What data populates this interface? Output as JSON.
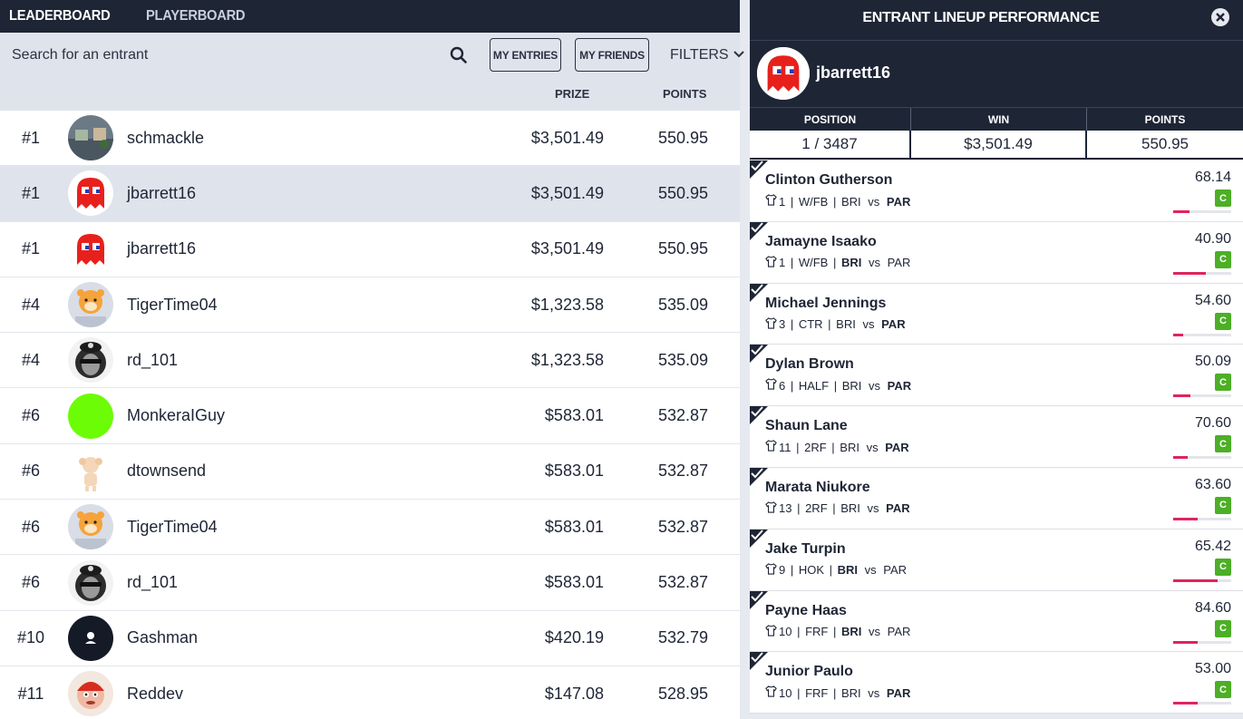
{
  "tabs": {
    "leaderboard": "LEADERBOARD",
    "playerboard": "PLAYERBOARD"
  },
  "search": {
    "placeholder": "Search for an entrant"
  },
  "buttons": {
    "my_entries": "MY ENTRIES",
    "my_friends": "MY FRIENDS",
    "filters": "FILTERS"
  },
  "columns": {
    "prize": "PRIZE",
    "points": "POINTS"
  },
  "entrants": [
    {
      "rank": "#1",
      "name": "schmackle",
      "prize": "$3,501.49",
      "points": "550.95",
      "avatar": "photo-avatar"
    },
    {
      "rank": "#1",
      "name": "jbarrett16",
      "prize": "$3,501.49",
      "points": "550.95",
      "avatar": "ghost-avatar",
      "selected": true
    },
    {
      "rank": "#1",
      "name": "jbarrett16",
      "prize": "$3,501.49",
      "points": "550.95",
      "avatar": "ghost-avatar"
    },
    {
      "rank": "#4",
      "name": "TigerTime04",
      "prize": "$1,323.58",
      "points": "535.09",
      "avatar": "tiger-avatar"
    },
    {
      "rank": "#4",
      "name": "rd_101",
      "prize": "$1,323.58",
      "points": "535.09",
      "avatar": "lion-avatar"
    },
    {
      "rank": "#6",
      "name": "MonkeraIGuy",
      "prize": "$583.01",
      "points": "532.87",
      "avatar": "green-avatar"
    },
    {
      "rank": "#6",
      "name": "dtownsend",
      "prize": "$583.01",
      "points": "532.87",
      "avatar": "doll-avatar"
    },
    {
      "rank": "#6",
      "name": "TigerTime04",
      "prize": "$583.01",
      "points": "532.87",
      "avatar": "tiger-avatar"
    },
    {
      "rank": "#6",
      "name": "rd_101",
      "prize": "$583.01",
      "points": "532.87",
      "avatar": "lion-avatar"
    },
    {
      "rank": "#10",
      "name": "Gashman",
      "prize": "$420.19",
      "points": "532.79",
      "avatar": "default-avatar"
    },
    {
      "rank": "#11",
      "name": "Reddev",
      "prize": "$147.08",
      "points": "528.95",
      "avatar": "cartoon-avatar"
    }
  ],
  "panel": {
    "title": "ENTRANT LINEUP PERFORMANCE",
    "username": "jbarrett16",
    "stat_labels": {
      "position": "POSITION",
      "win": "WIN",
      "points": "POINTS"
    },
    "stat_values": {
      "position": "1 / 3487",
      "win": "$3,501.49",
      "points": "550.95"
    },
    "players": [
      {
        "name": "Clinton Gutherson",
        "num": "1",
        "pos": "W/FB",
        "team": "BRI",
        "vs": "vs",
        "opp": "PAR",
        "bold": "opp",
        "points": "68.14",
        "badge": "C",
        "fill": 0.28
      },
      {
        "name": "Jamayne Isaako",
        "num": "1",
        "pos": "W/FB",
        "team": "BRI",
        "vs": "vs",
        "opp": "PAR",
        "bold": "team",
        "points": "40.90",
        "badge": "C",
        "fill": 0.56
      },
      {
        "name": "Michael Jennings",
        "num": "3",
        "pos": "CTR",
        "team": "BRI",
        "vs": "vs",
        "opp": "PAR",
        "bold": "opp",
        "points": "54.60",
        "badge": "C",
        "fill": 0.17
      },
      {
        "name": "Dylan Brown",
        "num": "6",
        "pos": "HALF",
        "team": "BRI",
        "vs": "vs",
        "opp": "PAR",
        "bold": "opp",
        "points": "50.09",
        "badge": "C",
        "fill": 0.3
      },
      {
        "name": "Shaun Lane",
        "num": "11",
        "pos": "2RF",
        "team": "BRI",
        "vs": "vs",
        "opp": "PAR",
        "bold": "opp",
        "points": "70.60",
        "badge": "C",
        "fill": 0.25
      },
      {
        "name": "Marata Niukore",
        "num": "13",
        "pos": "2RF",
        "team": "BRI",
        "vs": "vs",
        "opp": "PAR",
        "bold": "opp",
        "points": "63.60",
        "badge": "C",
        "fill": 0.42
      },
      {
        "name": "Jake Turpin",
        "num": "9",
        "pos": "HOK",
        "team": "BRI",
        "vs": "vs",
        "opp": "PAR",
        "bold": "team",
        "points": "65.42",
        "badge": "C",
        "fill": 0.77
      },
      {
        "name": "Payne Haas",
        "num": "10",
        "pos": "FRF",
        "team": "BRI",
        "vs": "vs",
        "opp": "PAR",
        "bold": "team",
        "points": "84.60",
        "badge": "C",
        "fill": 0.42
      },
      {
        "name": "Junior Paulo",
        "num": "10",
        "pos": "FRF",
        "team": "BRI",
        "vs": "vs",
        "opp": "PAR",
        "bold": "opp",
        "points": "53.00",
        "badge": "C",
        "fill": 0.42
      }
    ]
  },
  "colors": {
    "navy": "#1e2535",
    "highlight": "#dfe3ec",
    "badge_green": "#4caf26",
    "bar_pink": "#e0245e"
  }
}
